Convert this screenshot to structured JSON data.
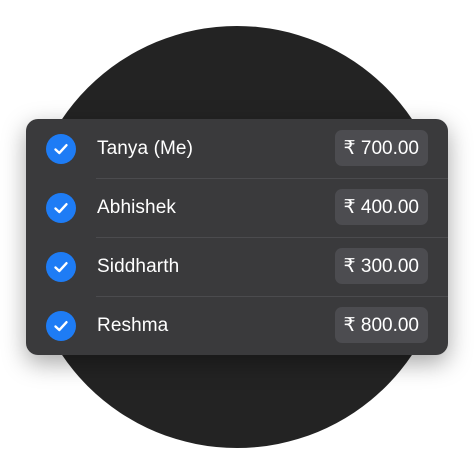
{
  "colors": {
    "background_circle": "#232323",
    "card": "#3a3a3c",
    "amount_pill": "#4c4c50",
    "check_accent": "#1e7cf5",
    "text": "#ffffff"
  },
  "participants": [
    {
      "name": "Tanya (Me)",
      "amount": "₹ 700.00",
      "checked": true,
      "icon": "checkmark-circle-icon"
    },
    {
      "name": "Abhishek",
      "amount": "₹ 400.00",
      "checked": true,
      "icon": "checkmark-circle-icon"
    },
    {
      "name": "Siddharth",
      "amount": "₹ 300.00",
      "checked": true,
      "icon": "checkmark-circle-icon"
    },
    {
      "name": "Reshma",
      "amount": "₹ 800.00",
      "checked": true,
      "icon": "checkmark-circle-icon"
    }
  ]
}
